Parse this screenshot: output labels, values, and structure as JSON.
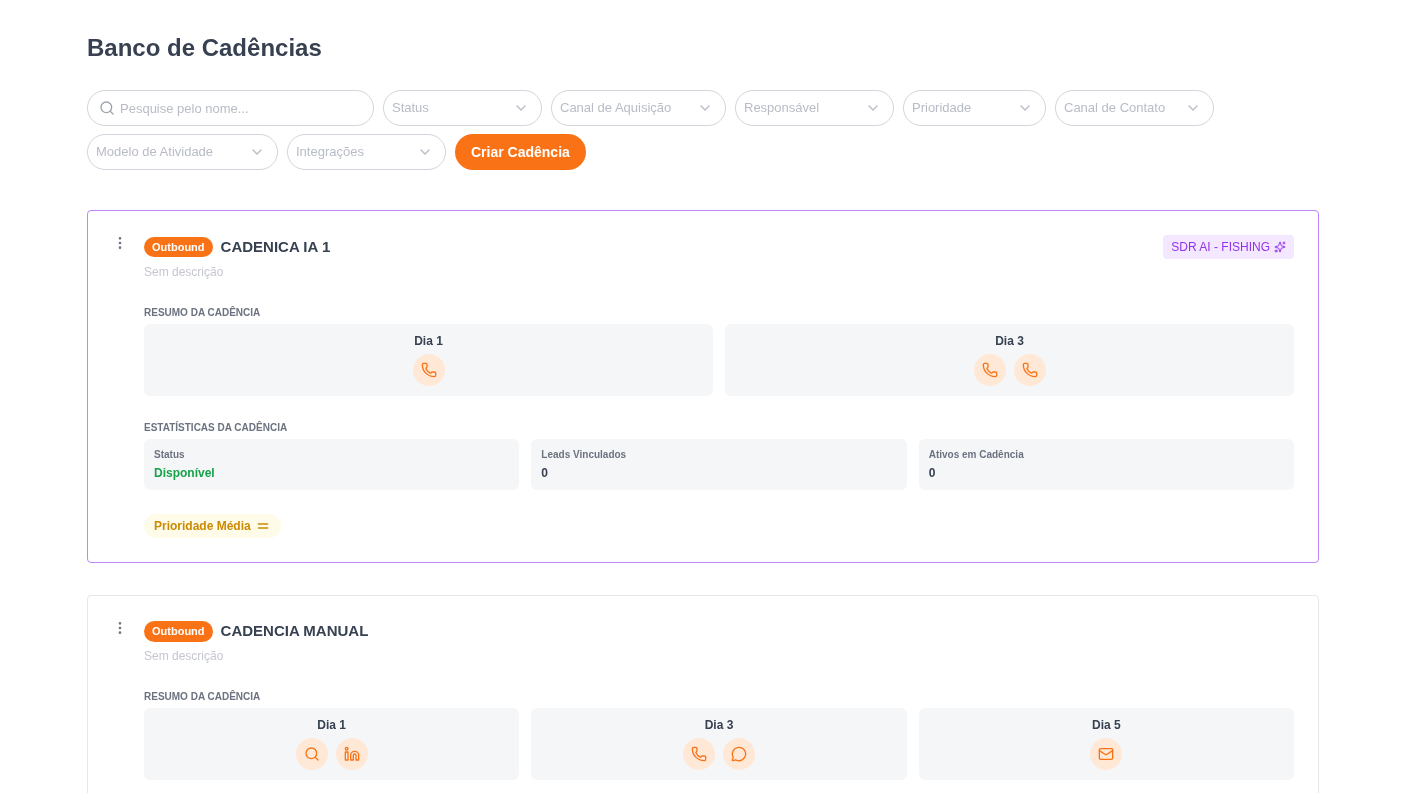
{
  "page_title": "Banco de Cadências",
  "filters": [
    {
      "kind": "search",
      "placeholder": "Pesquise pelo nome..."
    },
    {
      "kind": "select",
      "placeholder": "Status"
    },
    {
      "kind": "select",
      "placeholder": "Canal de Aquisição"
    },
    {
      "kind": "select",
      "placeholder": "Responsável"
    },
    {
      "kind": "select",
      "placeholder": "Prioridade"
    },
    {
      "kind": "select",
      "placeholder": "Canal de Contato"
    },
    {
      "kind": "select",
      "placeholder": "Modelo de Atividade"
    },
    {
      "kind": "select",
      "placeholder": "Integrações"
    }
  ],
  "create_button": "Criar Cadência",
  "cadences": [
    {
      "selected": true,
      "type_badge": "Outbound",
      "name": "CADENICA IA 1",
      "description": "Sem descrição",
      "ai_tag": "SDR AI - FISHING",
      "summary_label": "RESUMO DA CADÊNCIA",
      "days": [
        {
          "label": "Dia 1",
          "activities": [
            {
              "kind": "phone"
            }
          ]
        },
        {
          "label": "Dia 3",
          "activities": [
            {
              "kind": "phone"
            },
            {
              "kind": "phone"
            }
          ]
        }
      ],
      "stats_label": "ESTATÍSTICAS DA CADÊNCIA",
      "stats": [
        {
          "kind": "status",
          "label": "Status",
          "value": "Disponível"
        },
        {
          "kind": "number",
          "label": "Leads Vinculados",
          "value": "0"
        },
        {
          "kind": "number",
          "label": "Ativos em Cadência",
          "value": "0"
        }
      ],
      "priority": "Prioridade Média"
    },
    {
      "selected": false,
      "type_badge": "Outbound",
      "name": "CADENCIA MANUAL",
      "description": "Sem descrição",
      "summary_label": "RESUMO DA CADÊNCIA",
      "days": [
        {
          "label": "Dia 1",
          "activities": [
            {
              "kind": "search"
            },
            {
              "kind": "linkedin"
            }
          ]
        },
        {
          "label": "Dia 3",
          "activities": [
            {
              "kind": "phone"
            },
            {
              "kind": "whatsapp"
            }
          ]
        },
        {
          "label": "Dia 5",
          "activities": [
            {
              "kind": "email"
            }
          ]
        }
      ]
    }
  ]
}
